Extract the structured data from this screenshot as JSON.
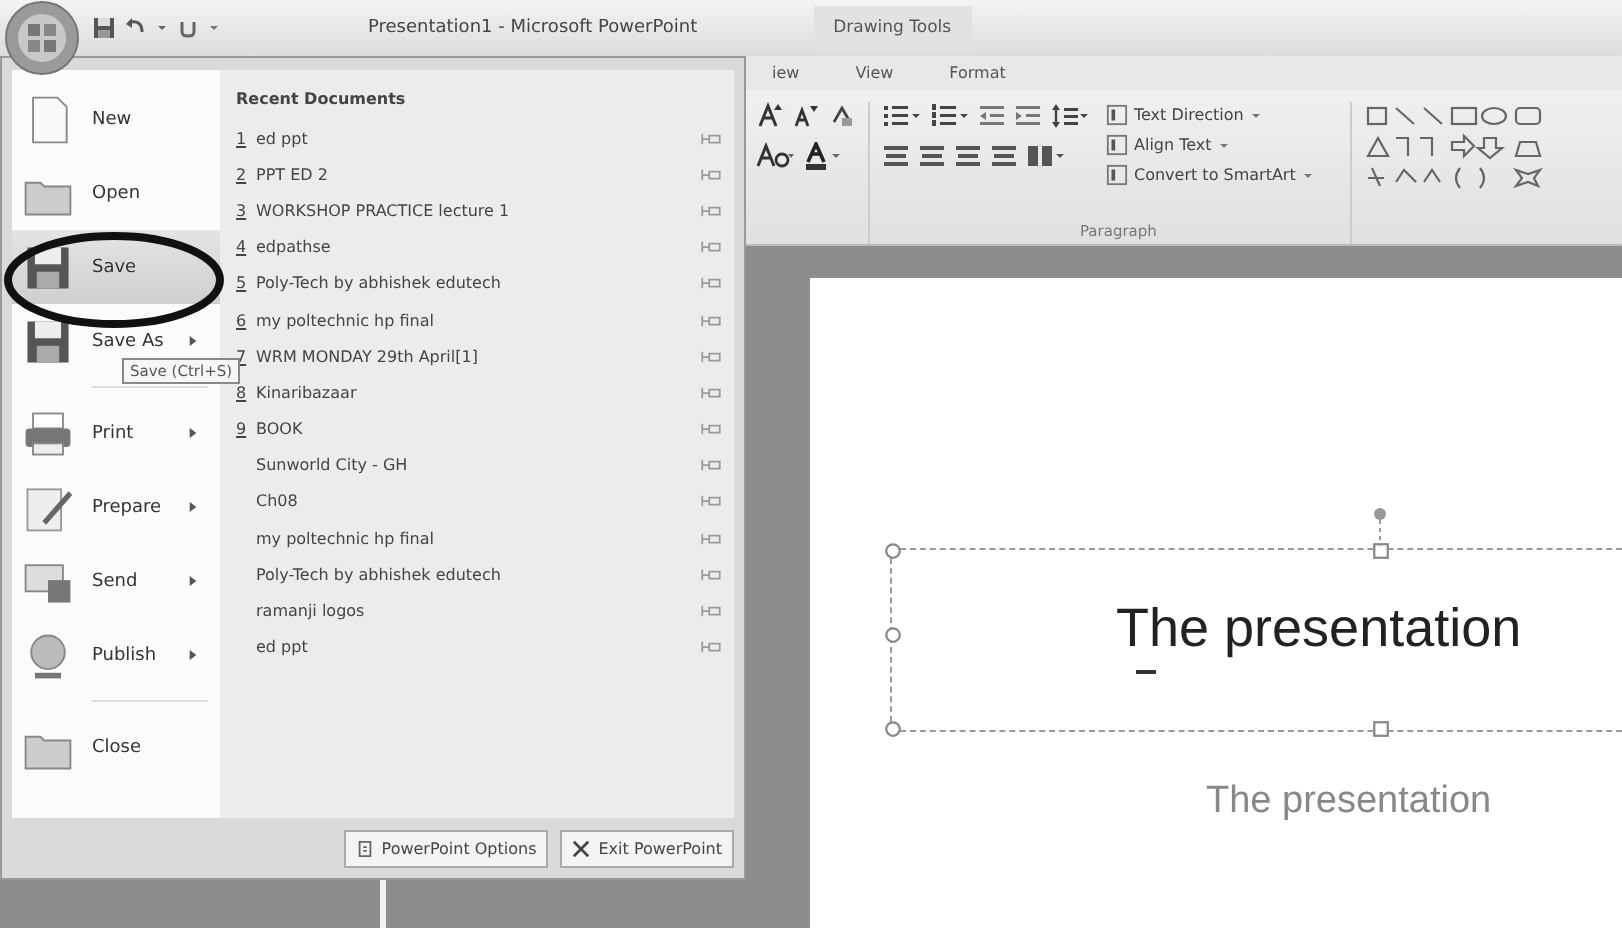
{
  "window": {
    "title": "Presentation1 - Microsoft PowerPoint",
    "contextual_group": "Drawing Tools"
  },
  "ribbon": {
    "tabs": [
      {
        "label": "iew",
        "selected": false
      },
      {
        "label": "View",
        "selected": false
      },
      {
        "label": "Format",
        "selected": false
      }
    ],
    "commands": [
      "Text Direction",
      "Align Text",
      "Convert to SmartArt"
    ],
    "group_label": "Paragraph"
  },
  "office_menu": {
    "items": [
      {
        "label": "New",
        "has_submenu": false,
        "selected": false
      },
      {
        "label": "Open",
        "has_submenu": false,
        "selected": false
      },
      {
        "label": "Save",
        "has_submenu": false,
        "selected": true
      },
      {
        "label": "Save As",
        "has_submenu": true,
        "selected": false
      },
      {
        "label": "Print",
        "has_submenu": true,
        "selected": false
      },
      {
        "label": "Prepare",
        "has_submenu": true,
        "selected": false
      },
      {
        "label": "Send",
        "has_submenu": true,
        "selected": false
      },
      {
        "label": "Publish",
        "has_submenu": true,
        "selected": false
      },
      {
        "label": "Close",
        "has_submenu": false,
        "selected": false
      }
    ],
    "tooltip": "Save (Ctrl+S)",
    "recent_header": "Recent Documents",
    "recent": [
      {
        "number": "1",
        "name": "ed ppt"
      },
      {
        "number": "2",
        "name": "PPT ED 2"
      },
      {
        "number": "3",
        "name": "WORKSHOP PRACTICE lecture 1"
      },
      {
        "number": "4",
        "name": "edpathse"
      },
      {
        "number": "5",
        "name": "Poly-Tech by abhishek edutech"
      },
      {
        "number": "6",
        "name": "my poltechnic hp final"
      },
      {
        "number": "7",
        "name": "WRM MONDAY 29th April[1]"
      },
      {
        "number": "8",
        "name": "Kinaribazaar"
      },
      {
        "number": "9",
        "name": "BOOK"
      },
      {
        "name": "Sunworld City - GH"
      },
      {
        "name": "Ch08"
      },
      {
        "name": "my poltechnic hp final"
      },
      {
        "name": "Poly-Tech by abhishek edutech"
      },
      {
        "name": "ramanji logos"
      },
      {
        "name": "ed ppt"
      }
    ],
    "footer_buttons": [
      "PowerPoint Options",
      "Exit PowerPoint"
    ]
  },
  "slide": {
    "title": "The presentation",
    "subtitle": "The presentation"
  }
}
